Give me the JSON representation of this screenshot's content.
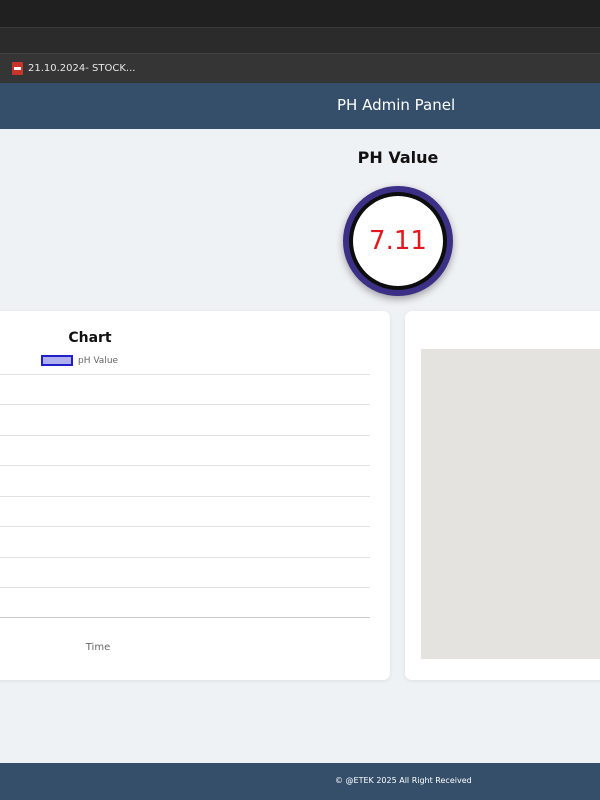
{
  "browser": {
    "bookmark_label": "21.10.2024- STOCK...",
    "bookmark_icon": "pdf-icon"
  },
  "header": {
    "title": "PH Admin Panel",
    "background": "#354f6b"
  },
  "ph": {
    "title": "PH Value",
    "value": "7.11",
    "value_color": "#e3181e",
    "ring_color": "#3b2f86"
  },
  "chart": {
    "title": "Chart",
    "legend_label": "pH Value",
    "x_axis_label": "Time"
  },
  "chart_data": {
    "type": "line",
    "title": "Chart",
    "series": [
      {
        "name": "pH Value",
        "values": []
      }
    ],
    "xlabel": "Time",
    "ylabel": "",
    "grid": true,
    "legend": "top"
  },
  "footer": {
    "text": "© @ETEK 2025 All Right Received"
  }
}
